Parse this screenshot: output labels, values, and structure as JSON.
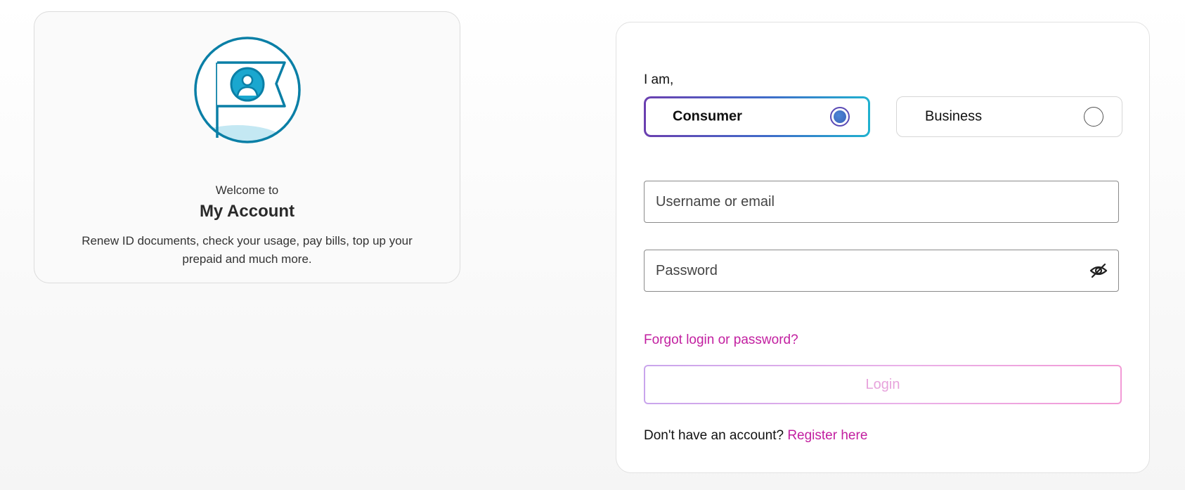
{
  "welcome": {
    "pre_title": "Welcome to",
    "title": "My Account",
    "description": "Renew ID documents, check your usage, pay bills, top up your prepaid and much more.",
    "illustration_icon": "account-flag-icon"
  },
  "login": {
    "iam_label": "I am,",
    "account_types": [
      {
        "label": "Consumer",
        "selected": true
      },
      {
        "label": "Business",
        "selected": false
      }
    ],
    "username": {
      "placeholder": "Username or email",
      "value": ""
    },
    "password": {
      "placeholder": "Password",
      "value": "",
      "toggle_icon": "eye-slash-icon"
    },
    "forgot_link": "Forgot login or password?",
    "login_button": "Login",
    "register_prompt": "Don't have an account?",
    "register_link": "Register here"
  },
  "colors": {
    "accent_magenta": "#c21fa0",
    "selected_gradient_start": "#6b3fb0",
    "selected_gradient_end": "#1fb1cf",
    "illustration_teal": "#0a7fa6",
    "login_button_text": "#e7a3dc"
  }
}
